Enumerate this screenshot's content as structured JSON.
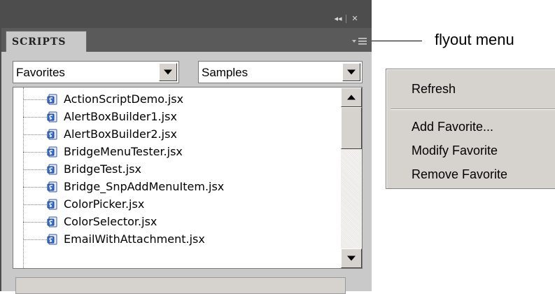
{
  "panel": {
    "tab_label": "SCRIPTS",
    "titlebar": {
      "collapse_glyph": "◂◂",
      "close_glyph": "✕"
    },
    "left_dropdown": {
      "value": "Favorites"
    },
    "right_dropdown": {
      "value": "Samples"
    },
    "scripts": [
      "ActionScriptDemo.jsx",
      "AlertBoxBuilder1.jsx",
      "AlertBoxBuilder2.jsx",
      "BridgeMenuTester.jsx",
      "BridgeTest.jsx",
      "Bridge_SnpAddMenuItem.jsx",
      "ColorPicker.jsx",
      "ColorSelector.jsx",
      "EmailWithAttachment.jsx"
    ]
  },
  "callout": {
    "label": "flyout menu"
  },
  "flyout_menu": {
    "items": [
      "Refresh",
      "Add Favorite...",
      "Modify Favorite",
      "Remove Favorite"
    ]
  },
  "icons": {
    "collapse": "double-chevron-left-icon",
    "close": "close-icon",
    "flyout": "flyout-menu-icon",
    "script_file": "script-file-icon",
    "dropdown": "chevron-down-icon"
  },
  "colors": {
    "panel_dark": "#4d4d4d",
    "panel_body": "#c9c9c9",
    "menu_bg": "#d6d3ce",
    "script_icon_blue": "#3b6fcf"
  }
}
